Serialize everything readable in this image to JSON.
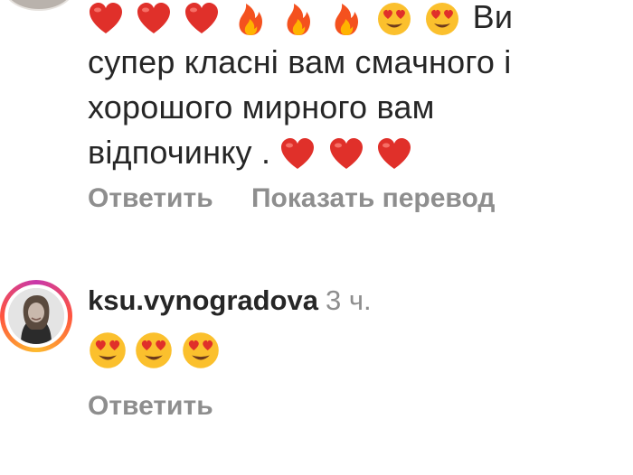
{
  "comment1": {
    "emojis": [
      "heart-red",
      "heart-red",
      "heart-red",
      "fire",
      "fire",
      "fire",
      "heart-eyes",
      "heart-eyes"
    ],
    "text_line1": "Ви",
    "text_line2": "супер класні вам смачного і",
    "text_line3": "хорошого мирного вам",
    "text_line4": "відпочинку .",
    "trailing_emojis": [
      "heart-red",
      "heart-red",
      "heart-red"
    ]
  },
  "actions1": {
    "reply_label": "Ответить",
    "translate_label": "Показать перевод"
  },
  "comment2": {
    "username": "ksu.vynogradova",
    "time": "3 ч.",
    "emojis": [
      "heart-eyes",
      "heart-eyes",
      "heart-eyes"
    ]
  },
  "actions2": {
    "reply_label": "Ответить"
  },
  "colors": {
    "text": "#262626",
    "secondary": "#8e8e8e",
    "heart": "#e0302a",
    "story_ring": [
      "#c837ab",
      "#ff543e",
      "#fdbb2d"
    ]
  }
}
